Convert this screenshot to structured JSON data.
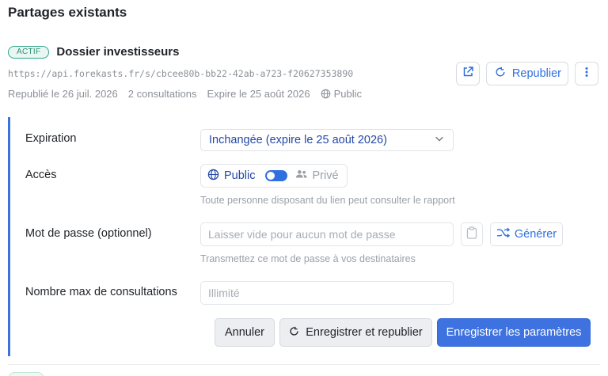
{
  "section": {
    "title": "Partages existants"
  },
  "share": {
    "status": "ACTIF",
    "name": "Dossier investisseurs",
    "url": "https://api.forekasts.fr/s/cbcee80b-bb22-42ab-a723-f20627353890",
    "published": "Republié le 26 juil. 2026",
    "views": "2 consultations",
    "expires": "Expire le 25 août 2026",
    "visibility": "Public"
  },
  "actions": {
    "open_icon": "external-link-icon",
    "republish_label": "Republier",
    "more_icon": "more-vertical-icon"
  },
  "form": {
    "expiration_label": "Expiration",
    "expiration_value": "Inchangée (expire le 25 août 2026)",
    "access_label": "Accès",
    "access_public": "Public",
    "access_private": "Privé",
    "access_hint": "Toute personne disposant du lien peut consulter le rapport",
    "password_label": "Mot de passe (optionnel)",
    "password_placeholder": "Laisser vide pour aucun mot de passe",
    "generate_label": "Générer",
    "password_hint": "Transmettez ce mot de passe à vos destinataires",
    "max_views_label": "Nombre max de consultations",
    "max_views_placeholder": "Illimité"
  },
  "buttons": {
    "cancel": "Annuler",
    "save_republish": "Enregistrer et republier",
    "save": "Enregistrer les paramètres"
  },
  "colors": {
    "accent": "#3d72e0",
    "active_badge": "#2da58a",
    "muted": "#8b9098"
  }
}
